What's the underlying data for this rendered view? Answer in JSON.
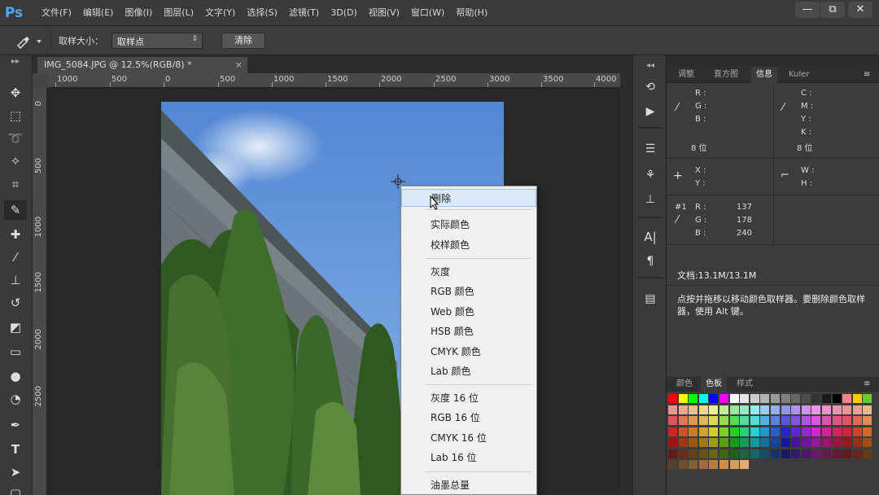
{
  "app": {
    "logo": "Ps"
  },
  "menubar": {
    "items": [
      "文件(F)",
      "编辑(E)",
      "图像(I)",
      "图层(L)",
      "文字(Y)",
      "选择(S)",
      "滤镜(T)",
      "3D(D)",
      "视图(V)",
      "窗口(W)",
      "帮助(H)"
    ],
    "window_controls": {
      "minimize": "—",
      "restore": "⧉",
      "close": "✕"
    }
  },
  "options_bar": {
    "tool_icon": "eyedropper-icon",
    "sample_size_label": "取样大小：",
    "sample_size_value": "取样点",
    "clear_button": "清除"
  },
  "document": {
    "tab_title": "IMG_5084.JPG @ 12.5%(RGB/8) *",
    "tab_close": "×"
  },
  "rulers": {
    "horizontal": [
      "1000",
      "500",
      "0",
      "500",
      "1000",
      "1500",
      "2000",
      "2500",
      "3000",
      "3500",
      "4000"
    ],
    "vertical": [
      "0",
      "500",
      "1000",
      "1500",
      "2000",
      "2500"
    ]
  },
  "context_menu": {
    "items": [
      {
        "label": "删除",
        "highlighted": true
      },
      {
        "label": "实际颜色"
      },
      {
        "label": "校样颜色"
      },
      {
        "label": "灰度"
      },
      {
        "label": "RGB 颜色"
      },
      {
        "label": "Web 颜色"
      },
      {
        "label": "HSB 颜色"
      },
      {
        "label": "CMYK 颜色"
      },
      {
        "label": "Lab 颜色"
      },
      {
        "label": "灰度 16 位"
      },
      {
        "label": "RGB 16 位"
      },
      {
        "label": "CMYK 16 位"
      },
      {
        "label": "Lab 16 位"
      },
      {
        "label": "油墨总量"
      }
    ]
  },
  "panels": {
    "info_tabs": [
      "调整",
      "直方图",
      "信息",
      "Kuler"
    ],
    "info_active": "信息",
    "rgb_labels": [
      "R :",
      "G :",
      "B :"
    ],
    "cmyk_labels": [
      "C :",
      "M :",
      "Y :",
      "K :"
    ],
    "bits_left": "8 位",
    "bits_right": "8 位",
    "xy_labels": [
      "X :",
      "Y :"
    ],
    "wh_labels": [
      "W :",
      "H :"
    ],
    "sample_id": "#1",
    "sample_labels": [
      "R :",
      "G :",
      "B :"
    ],
    "sample_values": [
      "137",
      "178",
      "240"
    ],
    "doc_size": "文档:13.1M/13.1M",
    "hint": "点按并拖移以移动颜色取样器。要删除颜色取样器，使用 Alt 键。",
    "swatch_tabs": [
      "颜色",
      "色板",
      "样式"
    ],
    "swatch_active": "色板"
  },
  "colors": {
    "sample_color": "#89b2f0",
    "swatches_row1": [
      "#ff0000",
      "#ffff00",
      "#00ff00",
      "#00ffff",
      "#0000ff",
      "#ff00ff",
      "#ffffff",
      "#e6e6e6",
      "#cccccc",
      "#b3b3b3",
      "#999999",
      "#808080",
      "#666666",
      "#4d4d4d",
      "#333333",
      "#1a1a1a",
      "#000000",
      "#ff8080",
      "#ffcc00",
      "#66cc33"
    ]
  }
}
